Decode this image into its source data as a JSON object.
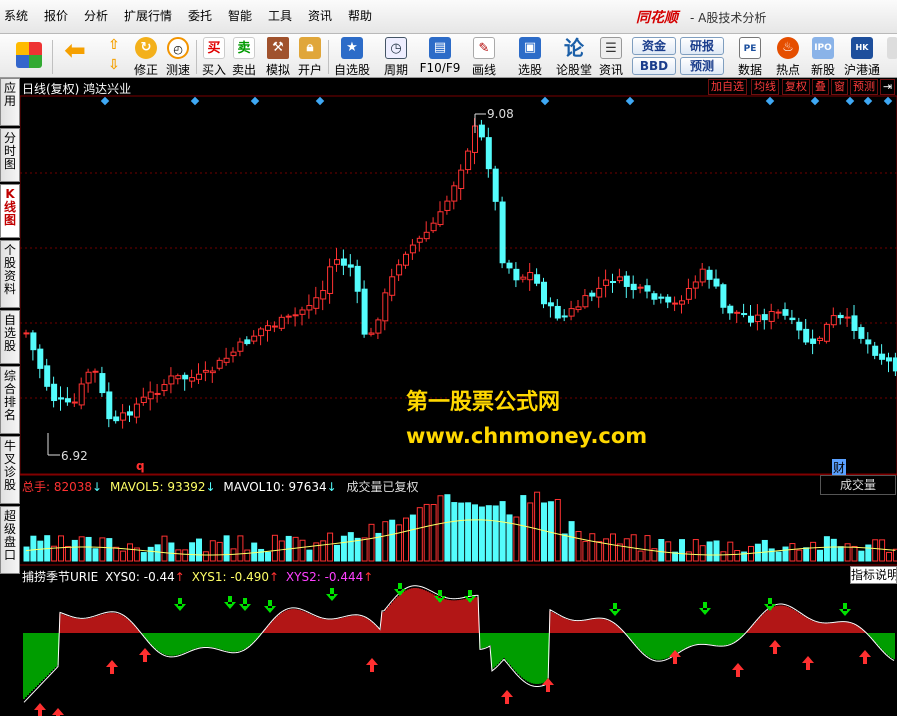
{
  "menu": [
    "系统",
    "报价",
    "分析",
    "扩展行情",
    "委托",
    "智能",
    "工具",
    "资讯",
    "帮助"
  ],
  "brand": {
    "name": "同花顺",
    "subtitle": "- A股技术分析"
  },
  "toolbar": {
    "buttons": [
      "修正",
      "测速",
      "买入",
      "卖出",
      "模拟",
      "开户",
      "自选股",
      "周期",
      "F10/F9",
      "画线",
      "选股",
      "论股堂",
      "资讯",
      "数据",
      "热点",
      "新股",
      "沪港通"
    ],
    "pills": [
      "资金",
      "BBD",
      "研报",
      "预测"
    ],
    "glyphs": {
      "buy": "买",
      "sell": "卖",
      "forum": "论"
    }
  },
  "left_tabs": [
    "应用",
    "分时图",
    "K线图",
    "个股资料",
    "自选股",
    "综合排名",
    "牛叉诊股",
    "超级盘口"
  ],
  "chart": {
    "header": "日线(复权)  鸿达兴业",
    "buttons": [
      "加自选",
      "均线",
      "复权",
      "叠",
      "窗",
      "预测"
    ],
    "high_label": "9.08",
    "low_label": "6.92",
    "q_marker": "q",
    "cai_marker": "财"
  },
  "watermark": {
    "line1": "第一股票公式网",
    "line2": "www.chnmoney.com"
  },
  "volume_panel": {
    "total_label": "总手: 82038",
    "mavol5": "MAVOL5: 93392",
    "mavol10": "MAVOL10: 97634",
    "note": "成交量已复权",
    "button": "成交量"
  },
  "indicator_panel": {
    "name": "捕捞季节URIE",
    "xys0": "XYS0: -0.44",
    "xys1": "XYS1: -0.490",
    "xys2": "XYS2: -0.444",
    "button": "指标说明"
  },
  "colors": {
    "up": "#ff3232",
    "down": "#54fcfc",
    "ma": "#ffff66",
    "indicator_pos": "#ff2020",
    "indicator_neg": "#00e000",
    "watermark1": "#ffd800",
    "watermark2": "#ffd800"
  }
}
